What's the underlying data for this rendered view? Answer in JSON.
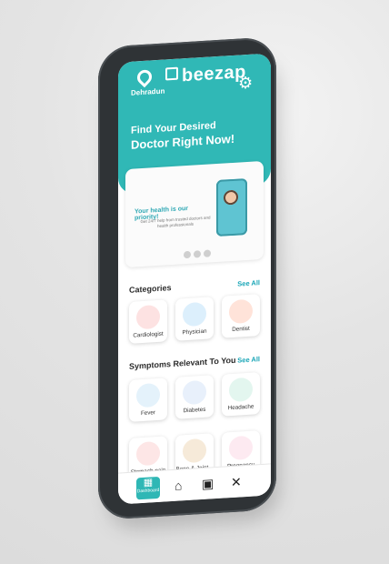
{
  "header": {
    "location": "Dehradun",
    "brand": "beezap",
    "headline": "Find Your Desired",
    "subheadline": "Doctor Right Now!"
  },
  "banner": {
    "title": "Your health is our priority!",
    "subtitle": "Get 24/7 help from trusted doctors and health professionals"
  },
  "sections": {
    "categories_title": "Categories",
    "categories_see_all": "See All",
    "symptoms_title": "Symptoms Relevant  To You",
    "symptoms_see_all": "See All"
  },
  "categories": [
    {
      "label": "Cardiologist",
      "icon": "heart-icon"
    },
    {
      "label": "Physician",
      "icon": "physician-icon"
    },
    {
      "label": "Dentist",
      "icon": "tooth-icon"
    }
  ],
  "symptoms_row1": [
    {
      "label": "Fever",
      "icon": "fever-icon"
    },
    {
      "label": "Diabetes",
      "icon": "diabetes-icon"
    },
    {
      "label": "Headache",
      "icon": "headache-icon"
    }
  ],
  "symptoms_row2": [
    {
      "label": "Stomach pain",
      "icon": "stomach-icon"
    },
    {
      "label": "Bone & Joint...",
      "icon": "bone-joint-icon"
    },
    {
      "label": "Pregnancy",
      "icon": "pregnancy-icon"
    }
  ],
  "bottom_nav": {
    "active_label": "Dashboard"
  },
  "colors": {
    "primary": "#30b8b6",
    "accent": "#1aa6b7"
  }
}
